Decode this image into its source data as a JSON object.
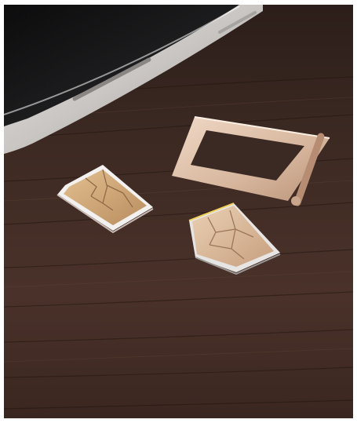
{
  "image": {
    "subject": "sim-cards-and-tray-on-wooden-table",
    "colors": {
      "wood_dark": "#2a1d19",
      "wood_mid": "#4a342c",
      "phone_silver": "#c9c6c3",
      "tray_gold": "#d8b9a0",
      "chip_gold": "#cda57a",
      "card_white": "#f3f1ef"
    },
    "icons": [
      "phone",
      "sim-tray",
      "sim-card",
      "sim-card"
    ]
  }
}
